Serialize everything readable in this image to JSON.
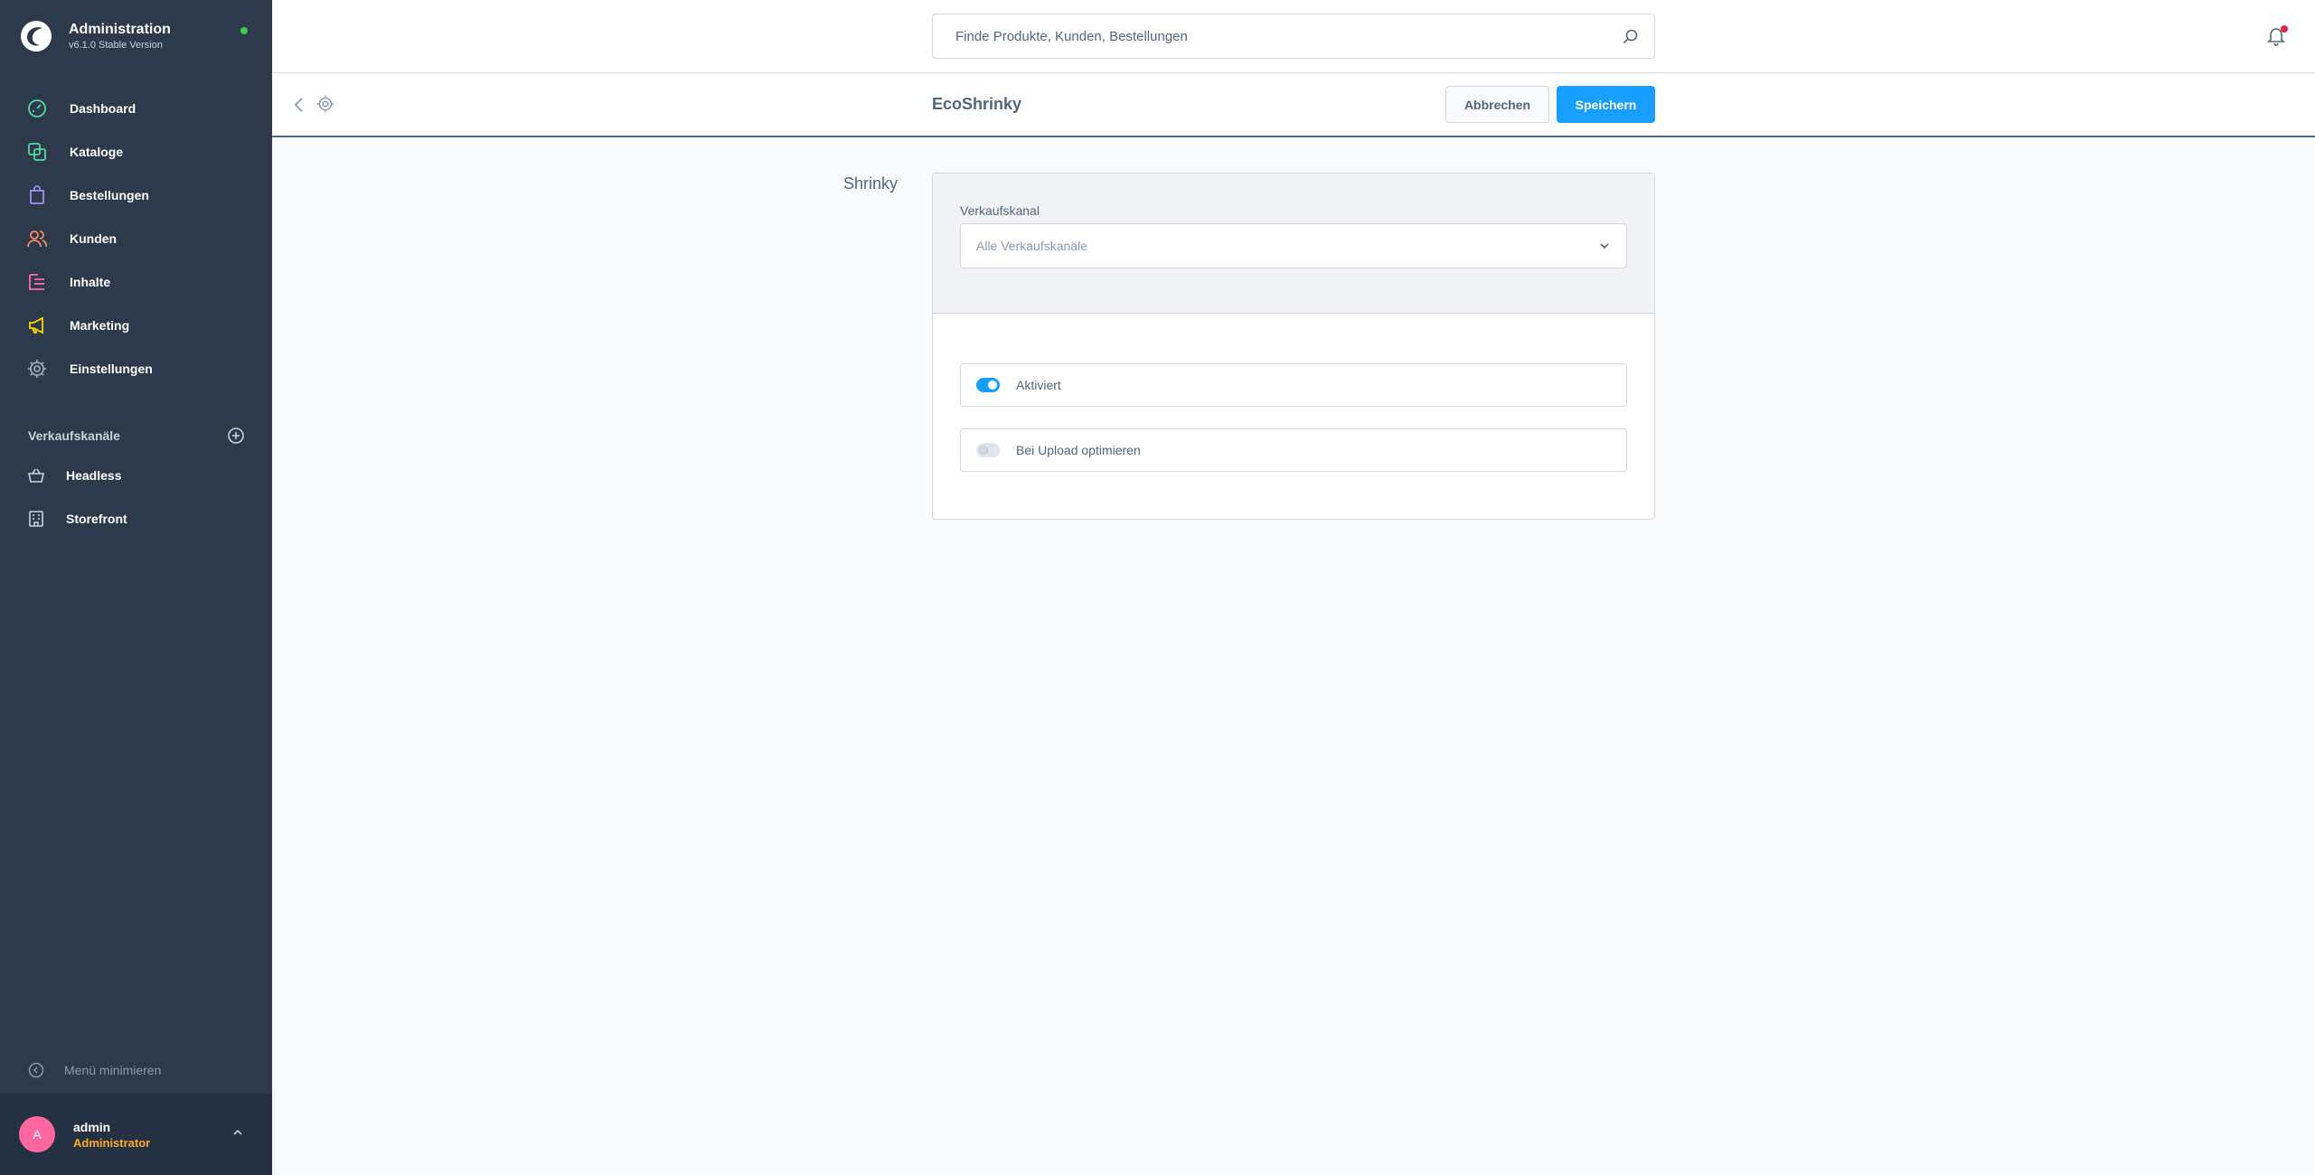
{
  "app": {
    "title": "Administration",
    "version": "v6.1.0 Stable Version"
  },
  "colors": {
    "sidebar_bg": "#2c3a4b",
    "accent": "#189eff",
    "status_online": "#37d046",
    "notification": "#de294c",
    "avatar": "#ff67a0",
    "role": "#ffab22"
  },
  "sidebar": {
    "items": [
      {
        "label": "Dashboard",
        "icon": "dashboard-icon",
        "color": "#57d9a3"
      },
      {
        "label": "Kataloge",
        "icon": "catalog-icon",
        "color": "#57d9a3"
      },
      {
        "label": "Bestellungen",
        "icon": "bag-icon",
        "color": "#a092f0"
      },
      {
        "label": "Kunden",
        "icon": "users-icon",
        "color": "#f88962"
      },
      {
        "label": "Inhalte",
        "icon": "content-icon",
        "color": "#ff68b4"
      },
      {
        "label": "Marketing",
        "icon": "megaphone-icon",
        "color": "#ffd700"
      },
      {
        "label": "Einstellungen",
        "icon": "gear-icon",
        "color": "#9aa8b5"
      }
    ],
    "channels_title": "Verkaufskanäle",
    "channels": [
      {
        "label": "Headless",
        "icon": "basket-icon"
      },
      {
        "label": "Storefront",
        "icon": "storefront-icon"
      }
    ],
    "minimize_label": "Menü minimieren"
  },
  "user": {
    "initial": "A",
    "name": "admin",
    "role": "Administrator"
  },
  "search": {
    "placeholder": "Finde Produkte, Kunden, Bestellungen"
  },
  "smartbar": {
    "title": "EcoShrinky",
    "cancel_label": "Abbrechen",
    "save_label": "Speichern"
  },
  "content": {
    "section_label": "Shrinky",
    "channel_field_label": "Verkaufskanal",
    "channel_select_value": "Alle Verkaufskanäle",
    "toggles": [
      {
        "label": "Aktiviert",
        "on": true
      },
      {
        "label": "Bei Upload optimieren",
        "on": false
      }
    ]
  }
}
